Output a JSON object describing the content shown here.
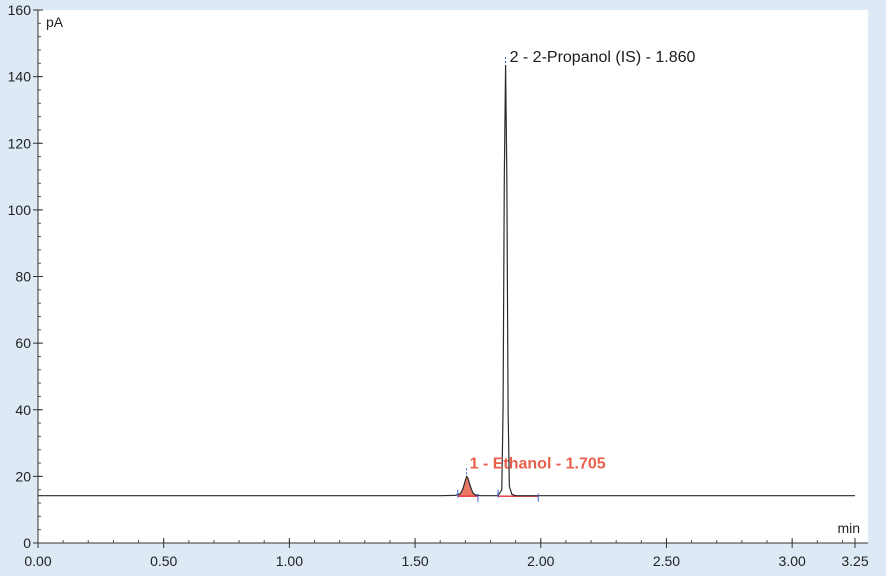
{
  "chart_data": {
    "type": "line",
    "title": "",
    "ylabel": "pA",
    "xlabel": "min",
    "xlim": [
      0,
      3.25
    ],
    "ylim": [
      0,
      160
    ],
    "x_ticks": [
      "0.00",
      "0.50",
      "1.00",
      "1.50",
      "2.00",
      "2.50",
      "3.00",
      "3.25"
    ],
    "x_tick_values": [
      0,
      0.5,
      1.0,
      1.5,
      2.0,
      2.5,
      3.0,
      3.25
    ],
    "y_ticks": [
      "0",
      "20",
      "40",
      "60",
      "80",
      "100",
      "120",
      "140",
      "160"
    ],
    "y_tick_values": [
      0,
      20,
      40,
      60,
      80,
      100,
      120,
      140,
      160
    ],
    "baseline": 14.2,
    "series": [
      {
        "points": [
          [
            0.0,
            14.2
          ],
          [
            1.6,
            14.2
          ],
          [
            1.66,
            14.3
          ],
          [
            1.68,
            14.8
          ],
          [
            1.69,
            16.2
          ],
          [
            1.7,
            18.8
          ],
          [
            1.705,
            20.0
          ],
          [
            1.71,
            19.5
          ],
          [
            1.72,
            17.0
          ],
          [
            1.73,
            15.0
          ],
          [
            1.74,
            14.4
          ],
          [
            1.76,
            14.2
          ],
          [
            1.83,
            14.2
          ],
          [
            1.845,
            16.0
          ],
          [
            1.85,
            40.0
          ],
          [
            1.855,
            110.0
          ],
          [
            1.86,
            143.5
          ],
          [
            1.865,
            110.0
          ],
          [
            1.87,
            40.0
          ],
          [
            1.875,
            17.0
          ],
          [
            1.885,
            14.6
          ],
          [
            1.9,
            14.2
          ],
          [
            3.25,
            14.2
          ]
        ]
      }
    ],
    "peaks": [
      {
        "label": "1 - Ethanol - 1.705",
        "rt": 1.705,
        "height": 20.0,
        "start": 1.67,
        "end": 1.75,
        "color": "#e8604c"
      },
      {
        "label": "2 - 2-Propanol (IS) - 1.860",
        "rt": 1.86,
        "height": 143.5,
        "start": 1.83,
        "end": 1.99,
        "color": "#1a1a1a"
      }
    ],
    "colors": {
      "trace": "#2b2b2b",
      "peak_fill": "#e8604c",
      "integration_line": "#e23030",
      "peak_markers": "#3b5bd6",
      "plot_background": "#ffffff",
      "frame_background": "#dde9f5"
    },
    "grid": false,
    "legend": "none"
  }
}
